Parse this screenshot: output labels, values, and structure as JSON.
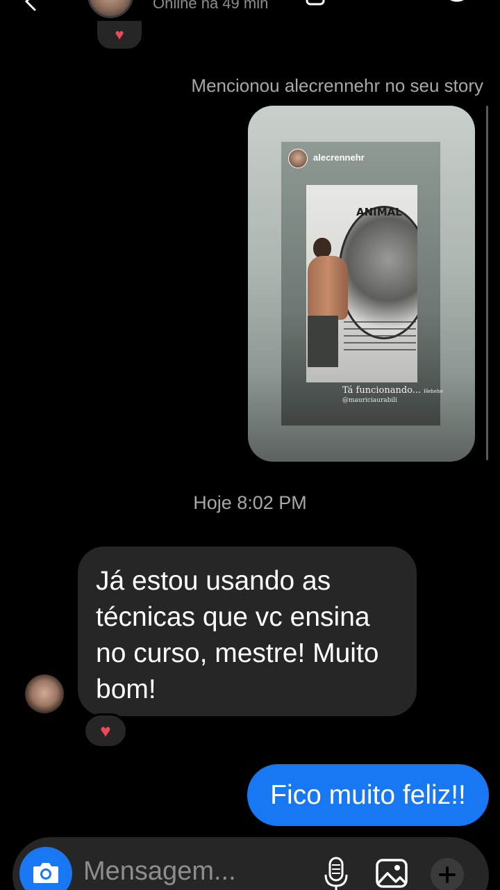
{
  "header": {
    "status": "Online há 49 min"
  },
  "reactions": {
    "top": "♥",
    "bottom": "♥"
  },
  "story_mention": {
    "label": "Mencionou alecrennehr no seu story",
    "username": "alecrennehr",
    "mural_text": "ANIMAL",
    "caption": "Tá funcionando...",
    "caption_small": "Hehehe",
    "tag": "@mauriciaurabili"
  },
  "timestamp": "Hoje 8:02 PM",
  "messages": {
    "incoming": "Já estou usando as técnicas que vc ensina no curso, mestre! Muito bom!",
    "outgoing": "Fico muito feliz!!"
  },
  "composer": {
    "placeholder": "Mensagem..."
  },
  "colors": {
    "background": "#000000",
    "bubble_incoming": "#262626",
    "bubble_outgoing": "#1877f2",
    "reaction_heart": "#ed4956",
    "secondary_text": "#a8a8a8"
  },
  "icons": [
    "back-icon",
    "video-icon",
    "phone-icon",
    "info-icon",
    "heart-icon",
    "camera-icon",
    "microphone-icon",
    "gallery-icon",
    "plus-icon"
  ]
}
